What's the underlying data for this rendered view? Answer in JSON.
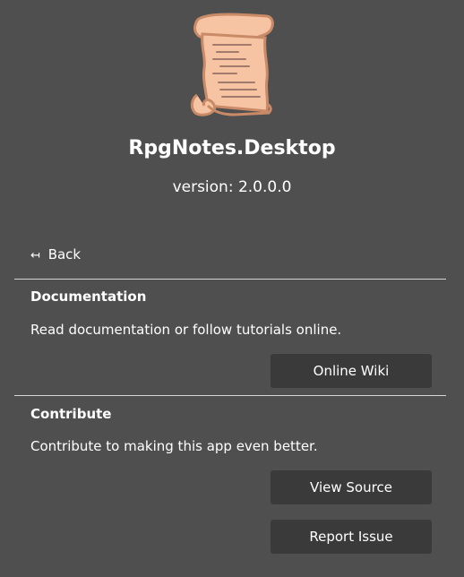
{
  "app": {
    "name": "RpgNotes.Desktop",
    "version": "version: 2.0.0.0",
    "logo_icon": "scroll-icon"
  },
  "nav": {
    "back_arrow": "↤",
    "back_label": "Back"
  },
  "documentation": {
    "title": "Documentation",
    "description": "Read documentation or follow tutorials online.",
    "button_label": "Online Wiki"
  },
  "contribute": {
    "title": "Contribute",
    "description": "Contribute to making this app even better.",
    "view_source_label": "View Source",
    "report_issue_label": "Report Issue"
  },
  "colors": {
    "background": "#4f4f4f",
    "button_background": "#3a3a3a",
    "divider": "#d6d6d6",
    "scroll_fill": "#f6c4a2",
    "scroll_outline": "#c98a67"
  }
}
